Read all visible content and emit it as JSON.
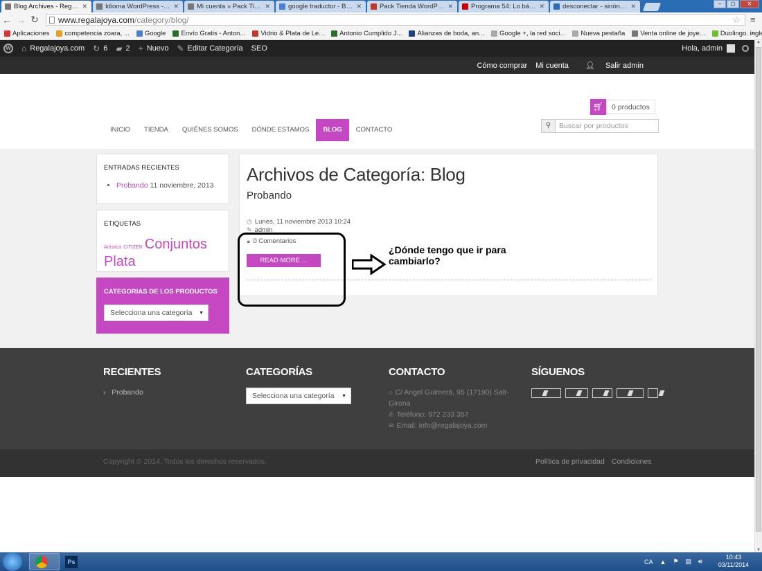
{
  "browser": {
    "tabs": [
      {
        "label": "Blog Archives - Regalajoya",
        "active": true,
        "color": "#777777"
      },
      {
        "label": "Idioma WordPress - Regal",
        "active": false,
        "color": "#777777"
      },
      {
        "label": "Mi cuenta » Pack Tienda",
        "active": false,
        "color": "#777777"
      },
      {
        "label": "google traductor - Buscar",
        "active": false,
        "color": "#4a7fd6"
      },
      {
        "label": "Pack Tienda WordPress -",
        "active": false,
        "color": "#c0392b"
      },
      {
        "label": "Programa 54: Lo básico",
        "active": false,
        "color": "#cc0000"
      },
      {
        "label": "desconectar - sinónimos",
        "active": false,
        "color": "#2a6db5"
      }
    ],
    "url_host": "www.regalajoya.com",
    "url_path": "/category/blog/",
    "bookmarks": [
      {
        "label": "Aplicaciones",
        "color": "#d33"
      },
      {
        "label": "competencia zoara, ...",
        "color": "#e8a020"
      },
      {
        "label": "Google",
        "color": "#4a7fd6"
      },
      {
        "label": "Envío Gratis - Anton...",
        "color": "#2b6e2b"
      },
      {
        "label": "Vidrio & Plata de Le...",
        "color": "#c0392b"
      },
      {
        "label": "Antonio Cumplido J...",
        "color": "#2b6e2b"
      },
      {
        "label": "Alianzas de boda, an...",
        "color": "#1b3f8f"
      },
      {
        "label": "Google +, la red soci...",
        "color": "#aaaaaa"
      },
      {
        "label": "Nueva pestaña",
        "color": "#aaaaaa"
      },
      {
        "label": "Venta online de joye...",
        "color": "#777777"
      },
      {
        "label": "Duolingo. ingles",
        "color": "#6fbf2f"
      }
    ]
  },
  "adminbar": {
    "site": "Regalajoya.com",
    "updates": "6",
    "comments": "2",
    "new": "Nuevo",
    "edit": "Editar Categoría",
    "seo": "SEO",
    "greeting": "Hola, admin"
  },
  "topbar": {
    "how_to_buy": "Cómo comprar",
    "my_account": "Mi cuenta",
    "logout": "Salir admin"
  },
  "nav": [
    {
      "label": "INICIO",
      "active": false
    },
    {
      "label": "TIENDA",
      "active": false
    },
    {
      "label": "QUIÉNES SOMOS",
      "active": false
    },
    {
      "label": "DÓNDE ESTAMOS",
      "active": false
    },
    {
      "label": "BLOG",
      "active": true
    },
    {
      "label": "CONTACTO",
      "active": false
    }
  ],
  "cart": {
    "count_label": "0 productos"
  },
  "search": {
    "placeholder": "Buscar por productos"
  },
  "sidebar": {
    "recent_title": "ENTRADAS RECIENTES",
    "recent_post": "Probando",
    "recent_date": "11 noviembre, 2013",
    "tags_title": "ETIQUETAS",
    "tags": [
      "Artistica",
      "CITIZEN",
      "Conjuntos",
      "Plata"
    ],
    "product_cats_title": "CATEGORIAS DE LOS PRODUCTOS",
    "product_cats_select": "Selecciona una categoría"
  },
  "main": {
    "title": "Archivos de Categoría: Blog",
    "post_title": "Probando",
    "date": "Lunes, 11 noviembre 2013 10:24",
    "author": "admin",
    "comments": "0 Comentarios",
    "read_more": "READ MORE ..."
  },
  "annotation": {
    "text": "¿Dónde tengo que ir para cambiarlo?"
  },
  "footer": {
    "recent_title": "RECIENTES",
    "recent_item": "Probando",
    "categories_title": "CATEGORÍAS",
    "categories_select": "Selecciona una categoría",
    "contact_title": "CONTACTO",
    "address": "C/ Angel Guimerà, 95 (17190) Salt-Girona",
    "phone": "Teléfono: 972 233 357",
    "email": "Email: info@regalajoya.com",
    "follow_title": "SÍGUENOS",
    "copyright": "Copyright © 2014. Todos los derechos reservados.",
    "privacy": "Política de privacidad",
    "conditions": "Condiciones"
  },
  "taskbar": {
    "lang": "CA",
    "time": "10:43",
    "date": "03/11/2014"
  },
  "colors": {
    "accent": "#c548c2",
    "dark_footer": "#3f3f3f"
  }
}
